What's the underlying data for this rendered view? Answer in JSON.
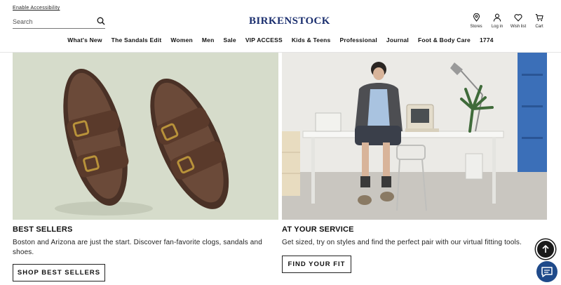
{
  "header": {
    "accessibility_link": "Enable Accessibility",
    "search": {
      "placeholder": "Search",
      "icon": "search-icon"
    },
    "logo": "BIRKENSTOCK",
    "utility": [
      {
        "label": "Stores",
        "icon": "map-pin-icon"
      },
      {
        "label": "Log in",
        "icon": "user-icon"
      },
      {
        "label": "Wish list",
        "icon": "heart-icon"
      },
      {
        "label": "Cart",
        "icon": "cart-icon"
      }
    ]
  },
  "nav": {
    "items": [
      "What's New",
      "The Sandals Edit",
      "Women",
      "Men",
      "Sale",
      "VIP ACCESS",
      "Kids & Teens",
      "Professional",
      "Journal",
      "Foot & Body Care",
      "1774"
    ]
  },
  "promos": [
    {
      "title": "BEST SELLERS",
      "text": "Boston and Arizona are just the start. Discover fan-favorite clogs, sandals and shoes.",
      "button": "SHOP BEST SELLERS"
    },
    {
      "title": "AT YOUR SERVICE",
      "text": "Get sized, try on styles and find the perfect pair with our virtual fitting tools.",
      "button": "FIND YOUR FIT"
    }
  ],
  "floating": {
    "back_to_top_icon": "arrow-up-icon",
    "chat_icon": "chat-icon"
  },
  "colors": {
    "brand": "#1a2e6e",
    "chat": "#1f4a8a",
    "left_image_background": "#d6dccb",
    "right_image_background": "#ebeae6"
  }
}
